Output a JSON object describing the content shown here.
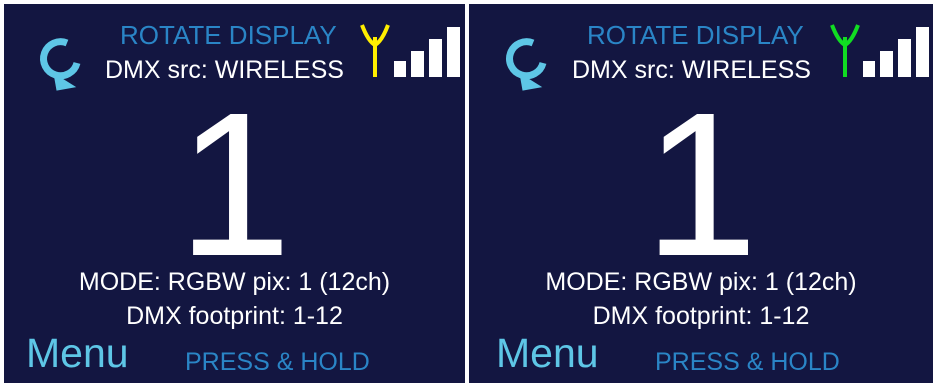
{
  "panels": [
    {
      "rotate_label": "ROTATE DISPLAY",
      "dmx_src": "DMX src: WIRELESS",
      "channel_number": "1",
      "mode": "MODE: RGBW pix: 1 (12ch)",
      "footprint": "DMX footprint: 1-12",
      "menu_label": "Menu",
      "press_hold": "PRESS & HOLD",
      "antenna_color": "#ffee00",
      "signal_bars_active": 4
    },
    {
      "rotate_label": "ROTATE DISPLAY",
      "dmx_src": "DMX src: WIRELESS",
      "channel_number": "1",
      "mode": "MODE: RGBW pix: 1 (12ch)",
      "footprint": "DMX footprint: 1-12",
      "menu_label": "Menu",
      "press_hold": "PRESS & HOLD",
      "antenna_color": "#11dd22",
      "signal_bars_active": 4
    }
  ],
  "colors": {
    "background": "#131641",
    "accent_blue": "#2a85c6",
    "accent_cyan": "#5ec6e6",
    "text": "#ffffff"
  },
  "icons": {
    "rotate": "rotate-icon",
    "antenna": "antenna-icon",
    "signal": "signal-strength-icon"
  }
}
